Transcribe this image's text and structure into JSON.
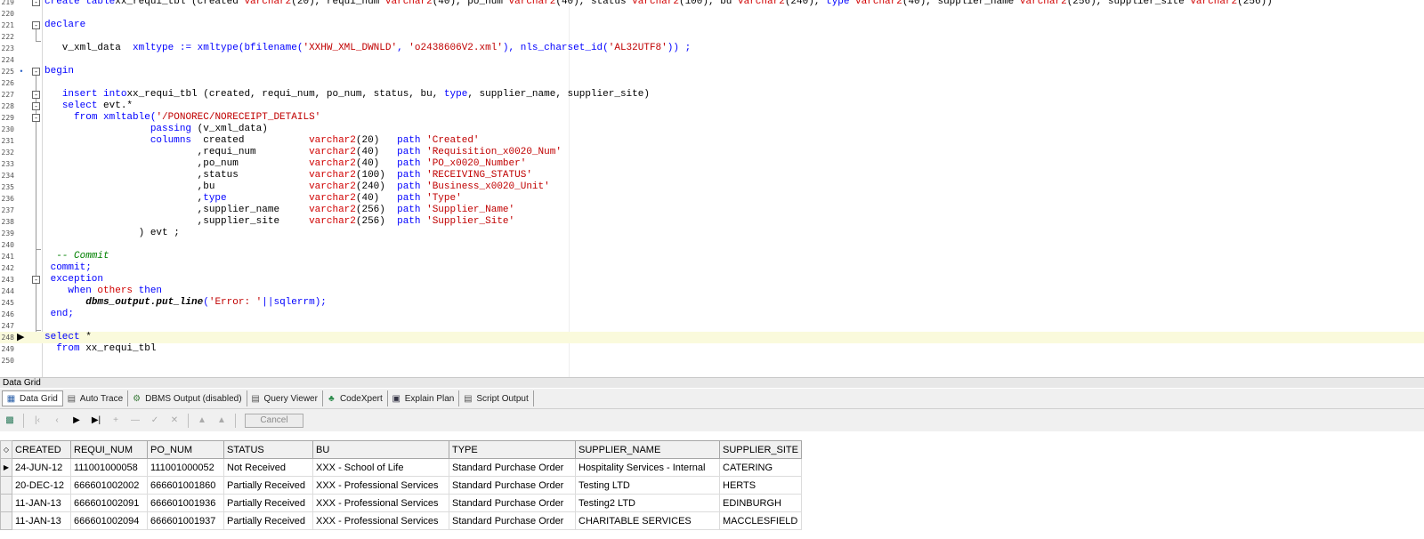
{
  "editor": {
    "lines": [
      {
        "num": "219",
        "fold": "−",
        "parts": [
          [
            "kw",
            "create table"
          ],
          [
            "",
            "xx_requi_tbl (created "
          ],
          [
            "ty",
            "varchar2"
          ],
          [
            "",
            "(20), requi_num "
          ],
          [
            "ty",
            "varchar2"
          ],
          [
            "",
            "(40), po_num "
          ],
          [
            "ty",
            "varchar2"
          ],
          [
            "",
            "(40), status "
          ],
          [
            "ty",
            "varchar2"
          ],
          [
            "",
            "(100), bu "
          ],
          [
            "ty",
            "varchar2"
          ],
          [
            "",
            "(240), "
          ],
          [
            "kw",
            "type"
          ],
          [
            "",
            ""
          ],
          [
            "ty",
            " varchar2"
          ],
          [
            "",
            "(40), supplier_name "
          ],
          [
            "ty",
            "varchar2"
          ],
          [
            "",
            "(256), supplier_site "
          ],
          [
            "ty",
            "varchar2"
          ],
          [
            "",
            "(256))"
          ]
        ]
      },
      {
        "num": "220",
        "parts": []
      },
      {
        "num": "221",
        "fold": "−",
        "parts": [
          [
            "kw",
            "declare"
          ]
        ]
      },
      {
        "num": "222",
        "parts": []
      },
      {
        "num": "223",
        "parts": [
          [
            "",
            "   v_xml_data  "
          ],
          [
            "kw",
            "xmltype := xmltype(bfilename("
          ],
          [
            "st",
            "'XXHW_XML_DWNLD'"
          ],
          [
            "kw",
            ", "
          ],
          [
            "st",
            "'o2438606V2.xml'"
          ],
          [
            "kw",
            "), nls_charset_id("
          ],
          [
            "st",
            "'AL32UTF8'"
          ],
          [
            "kw",
            ")) ;"
          ]
        ]
      },
      {
        "num": "224",
        "parts": []
      },
      {
        "num": "225",
        "marker": "dot",
        "fold": "−",
        "parts": [
          [
            "kw",
            "begin"
          ]
        ]
      },
      {
        "num": "226",
        "parts": []
      },
      {
        "num": "227",
        "fold": "−",
        "parts": [
          [
            "",
            "   "
          ],
          [
            "kw",
            "insert into"
          ],
          [
            "",
            ""
          ],
          [
            "",
            "xx_requi_tbl (created, requi_num, po_num, status, bu, "
          ],
          [
            "kw",
            "type"
          ],
          [
            "",
            ", supplier_name, supplier_site)"
          ]
        ]
      },
      {
        "num": "228",
        "fold": "−",
        "parts": [
          [
            "",
            "   "
          ],
          [
            "kw",
            "select"
          ],
          [
            "",
            ""
          ],
          [
            "",
            " evt.*"
          ]
        ]
      },
      {
        "num": "229",
        "fold": "−",
        "parts": [
          [
            "",
            "     "
          ],
          [
            "kw",
            "from xmltable("
          ],
          [
            "st",
            "'/PONOREC/NORECEIPT_DETAILS'"
          ]
        ]
      },
      {
        "num": "230",
        "parts": [
          [
            "",
            "                  "
          ],
          [
            "kw",
            "passing"
          ],
          [
            "",
            ""
          ],
          [
            "",
            " (v_xml_data)"
          ]
        ]
      },
      {
        "num": "231",
        "parts": [
          [
            "",
            "                  "
          ],
          [
            "kw",
            "columns"
          ],
          [
            "",
            "  created           "
          ],
          [
            "ty",
            "varchar2"
          ],
          [
            "",
            "(20)   "
          ],
          [
            "kw",
            "path"
          ],
          [
            "",
            ""
          ],
          [
            "st",
            " 'Created'"
          ]
        ]
      },
      {
        "num": "232",
        "parts": [
          [
            "",
            "                          ,requi_num         "
          ],
          [
            "ty",
            "varchar2"
          ],
          [
            "",
            "(40)   "
          ],
          [
            "kw",
            "path"
          ],
          [
            "st",
            " 'Requisition_x0020_Num'"
          ]
        ]
      },
      {
        "num": "233",
        "parts": [
          [
            "",
            "                          ,po_num            "
          ],
          [
            "ty",
            "varchar2"
          ],
          [
            "",
            "(40)   "
          ],
          [
            "kw",
            "path"
          ],
          [
            "st",
            " 'PO_x0020_Number'"
          ]
        ]
      },
      {
        "num": "234",
        "parts": [
          [
            "",
            "                          ,status            "
          ],
          [
            "ty",
            "varchar2"
          ],
          [
            "",
            "(100)  "
          ],
          [
            "kw",
            "path"
          ],
          [
            "st",
            " 'RECEIVING_STATUS'"
          ]
        ]
      },
      {
        "num": "235",
        "parts": [
          [
            "",
            "                          ,bu                "
          ],
          [
            "ty",
            "varchar2"
          ],
          [
            "",
            "(240)  "
          ],
          [
            "kw",
            "path"
          ],
          [
            "st",
            " 'Business_x0020_Unit'"
          ]
        ]
      },
      {
        "num": "236",
        "parts": [
          [
            "",
            "                          ,"
          ],
          [
            "kw",
            "type"
          ],
          [
            "",
            "              "
          ],
          [
            "ty",
            "varchar2"
          ],
          [
            "",
            "(40)   "
          ],
          [
            "kw",
            "path"
          ],
          [
            "st",
            " 'Type'"
          ]
        ]
      },
      {
        "num": "237",
        "parts": [
          [
            "",
            "                          ,supplier_name     "
          ],
          [
            "ty",
            "varchar2"
          ],
          [
            "",
            "(256)  "
          ],
          [
            "kw",
            "path"
          ],
          [
            "st",
            " 'Supplier_Name'"
          ]
        ]
      },
      {
        "num": "238",
        "parts": [
          [
            "",
            "                          ,supplier_site     "
          ],
          [
            "ty",
            "varchar2"
          ],
          [
            "",
            "(256)  "
          ],
          [
            "kw",
            "path"
          ],
          [
            "st",
            " 'Supplier_Site'"
          ]
        ]
      },
      {
        "num": "239",
        "parts": [
          [
            "",
            "                ) evt ;"
          ]
        ]
      },
      {
        "num": "240",
        "parts": []
      },
      {
        "num": "241",
        "parts": [
          [
            "",
            "  "
          ],
          [
            "cm",
            "-- Commit"
          ]
        ]
      },
      {
        "num": "242",
        "parts": [
          [
            "",
            ""
          ],
          [
            "kw",
            " commit;"
          ]
        ]
      },
      {
        "num": "243",
        "fold": "−",
        "parts": [
          [
            "kw",
            " exception"
          ]
        ]
      },
      {
        "num": "244",
        "parts": [
          [
            "",
            "    "
          ],
          [
            "kw",
            "when"
          ],
          [
            "ty",
            " others"
          ],
          [
            "kw",
            " then"
          ]
        ]
      },
      {
        "num": "245",
        "parts": [
          [
            "",
            "       "
          ],
          [
            "fn",
            "dbms_output.put_line"
          ],
          [
            "kw",
            "("
          ],
          [
            "st",
            "'Error: '"
          ],
          [
            "kw",
            "||sqlerrm);"
          ]
        ]
      },
      {
        "num": "246",
        "parts": [
          [
            "kw",
            " end;"
          ]
        ]
      },
      {
        "num": "247",
        "parts": []
      },
      {
        "num": "248",
        "marker": "arrow",
        "current": true,
        "parts": [
          [
            "kw",
            "select"
          ],
          [
            "",
            ""
          ],
          [
            "",
            " *"
          ]
        ]
      },
      {
        "num": "249",
        "parts": [
          [
            "",
            "  "
          ],
          [
            "kw",
            "from"
          ],
          [
            "",
            ""
          ],
          [
            "",
            " xx_requi_tbl"
          ]
        ]
      },
      {
        "num": "250",
        "parts": []
      }
    ]
  },
  "panel": {
    "title": "Data Grid",
    "tabs": [
      {
        "label": "Data Grid",
        "icon": "grid-icon",
        "active": true
      },
      {
        "label": "Auto Trace",
        "icon": "document-icon"
      },
      {
        "label": "DBMS Output (disabled)",
        "icon": "output-icon"
      },
      {
        "label": "Query Viewer",
        "icon": "document-icon"
      },
      {
        "label": "CodeXpert",
        "icon": "codexpert-icon"
      },
      {
        "label": "Explain Plan",
        "icon": "plan-icon"
      },
      {
        "label": "Script Output",
        "icon": "document-icon"
      }
    ],
    "cancel_label": "Cancel"
  },
  "grid": {
    "columns": [
      "CREATED",
      "REQUI_NUM",
      "PO_NUM",
      "STATUS",
      "BU",
      "TYPE",
      "SUPPLIER_NAME",
      "SUPPLIER_SITE"
    ],
    "rows": [
      [
        "24-JUN-12",
        "111001000058",
        "111001000052",
        "Not Received",
        "XXX - School of Life",
        "Standard Purchase Order",
        "Hospitality Services - Internal",
        "CATERING"
      ],
      [
        "20-DEC-12",
        "666601002002",
        "666601001860",
        "Partially Received",
        "XXX - Professional Services",
        "Standard Purchase Order",
        "Testing LTD",
        "HERTS"
      ],
      [
        "11-JAN-13",
        "666601002091",
        "666601001936",
        "Partially Received",
        "XXX - Professional Services",
        "Standard Purchase Order",
        "Testing2 LTD",
        "EDINBURGH"
      ],
      [
        "11-JAN-13",
        "666601002094",
        "666601001937",
        "Partially Received",
        "XXX - Professional Services",
        "Standard Purchase Order",
        "CHARITABLE SERVICES",
        "MACCLESFIELD"
      ]
    ]
  }
}
